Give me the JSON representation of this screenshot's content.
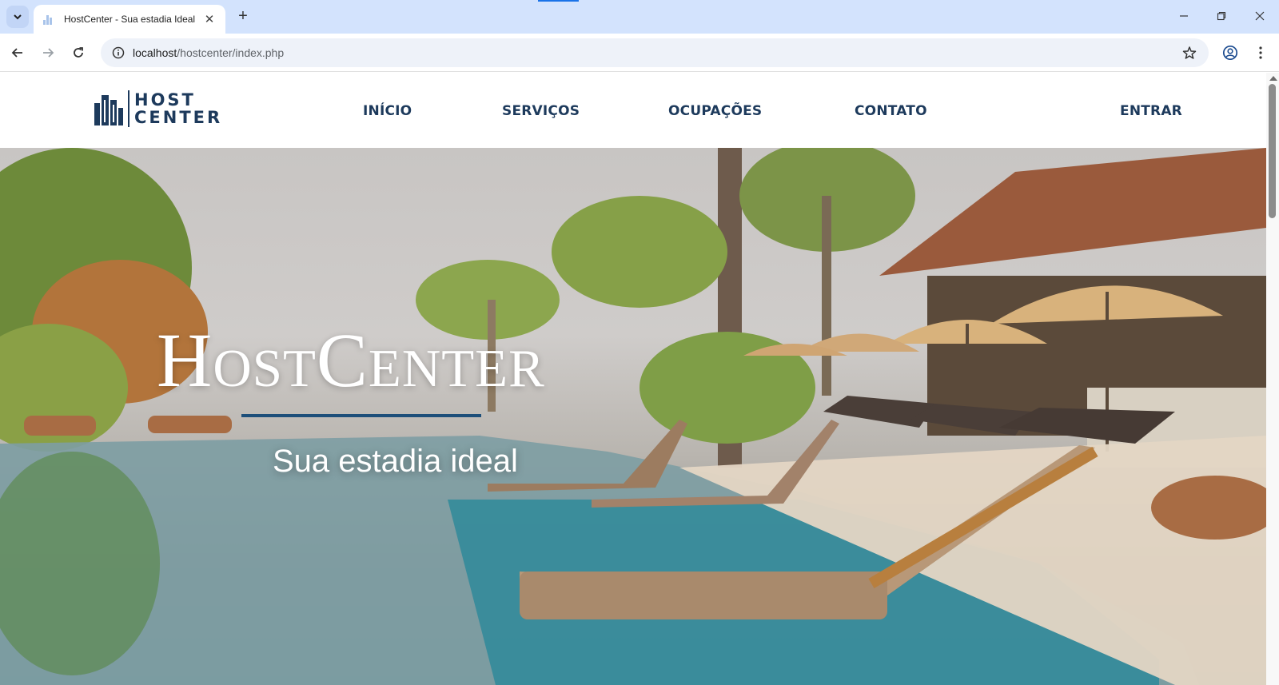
{
  "browser": {
    "tab_title": "HostCenter - Sua estadia Ideal",
    "url_host": "localhost",
    "url_path": "/hostcenter/index.php"
  },
  "site": {
    "logo": {
      "line1": "HOST",
      "line2": "CENTER"
    },
    "nav": [
      {
        "label": "INÍCIO"
      },
      {
        "label": "SERVIÇOS"
      },
      {
        "label": "OCUPAÇÕES"
      },
      {
        "label": "CONTATO"
      }
    ],
    "login_label": "ENTRAR",
    "hero": {
      "title": "HostCenter",
      "subtitle": "Sua estadia ideal"
    }
  },
  "colors": {
    "brand_navy": "#1d3a5c",
    "accent_line": "#1d4f7a",
    "chrome_bg": "#d3e3fd"
  },
  "icons": {
    "tab_search": "chevron-down-icon",
    "close_tab": "close-icon",
    "new_tab": "plus-icon",
    "back": "arrow-left-icon",
    "forward": "arrow-right-icon",
    "reload": "reload-icon",
    "site_info": "info-icon",
    "bookmark": "star-icon",
    "profile": "profile-icon",
    "menu": "kebab-menu-icon"
  }
}
